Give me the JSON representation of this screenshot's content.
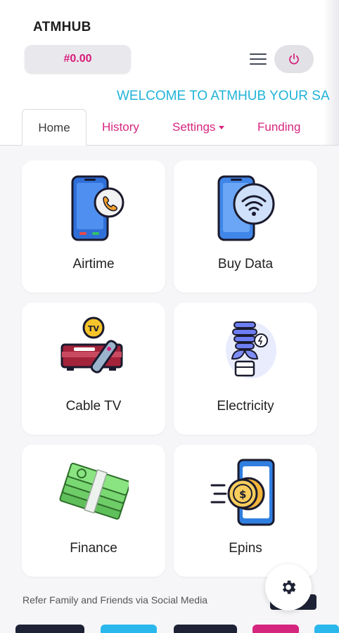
{
  "app": {
    "brand": "ATMHUB"
  },
  "header": {
    "balance": "#0.00",
    "marquee": "WELCOME TO ATMHUB YOUR SA"
  },
  "tabs": [
    {
      "label": "Home"
    },
    {
      "label": "History"
    },
    {
      "label": "Settings"
    },
    {
      "label": "Funding"
    }
  ],
  "services": [
    {
      "label": "Airtime",
      "icon": "phone-call-icon"
    },
    {
      "label": "Buy Data",
      "icon": "phone-wifi-icon"
    },
    {
      "label": "Cable TV",
      "icon": "tv-decoder-icon"
    },
    {
      "label": "Electricity",
      "icon": "lightbulb-icon"
    },
    {
      "label": "Finance",
      "icon": "cash-stack-icon"
    },
    {
      "label": "Epins",
      "icon": "phone-coin-icon"
    }
  ],
  "footer": {
    "refer_text": "Refer Family and Friends via Social Media"
  },
  "colors": {
    "accent": "#d5267f",
    "marquee": "#20b3d8",
    "balance_text": "#d81b7a"
  }
}
